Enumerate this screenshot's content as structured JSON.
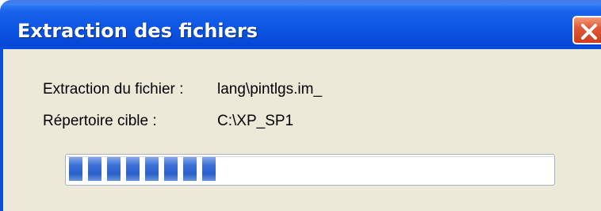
{
  "window": {
    "title": "Extraction des fichiers",
    "close_icon": "close-icon"
  },
  "fields": {
    "file_label": "Extraction du fichier :",
    "file_value": "lang\\pintlgs.im_",
    "dir_label": "Répertoire cible :",
    "dir_value": "C:\\XP_SP1"
  },
  "progress": {
    "fraction": 0.31,
    "block_count": 8,
    "color": "#2a5fcc"
  },
  "colors": {
    "titlebar": "#0a53e0",
    "dialog_background": "#ece9d8",
    "close_button": "#e2583a"
  }
}
